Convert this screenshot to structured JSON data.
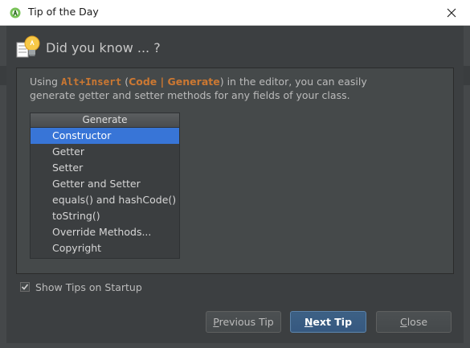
{
  "window": {
    "title": "Tip of the Day",
    "icon": "android-studio-icon",
    "close_icon": "close-icon"
  },
  "tip": {
    "heading": "Did you know ... ?",
    "line1_prefix": "Using ",
    "shortcut": "Alt+Insert",
    "paren_open": " (",
    "menu_path": "Code | Generate",
    "line1_suffix": ") in the editor, you can easily",
    "line2": "generate getter and setter methods for any fields of your class."
  },
  "generate_popup": {
    "title": "Generate",
    "items": [
      {
        "label": "Constructor",
        "selected": true
      },
      {
        "label": "Getter",
        "selected": false
      },
      {
        "label": "Setter",
        "selected": false
      },
      {
        "label": "Getter and Setter",
        "selected": false
      },
      {
        "label": "equals() and hashCode()",
        "selected": false
      },
      {
        "label": "toString()",
        "selected": false
      },
      {
        "label": "Override Methods...",
        "selected": false
      },
      {
        "label": "Copyright",
        "selected": false
      }
    ]
  },
  "options": {
    "show_tips_label": "Show Tips on Startup",
    "show_tips_checked": true
  },
  "buttons": {
    "previous_first": "P",
    "previous_rest": "revious Tip",
    "next_first": "N",
    "next_rest": "ext Tip",
    "close_first": "C",
    "close_rest": "lose"
  },
  "colors": {
    "background": "#3c3f41",
    "accent_orange": "#cc7832",
    "selection_blue": "#3875d7",
    "primary_button": "#365880"
  }
}
